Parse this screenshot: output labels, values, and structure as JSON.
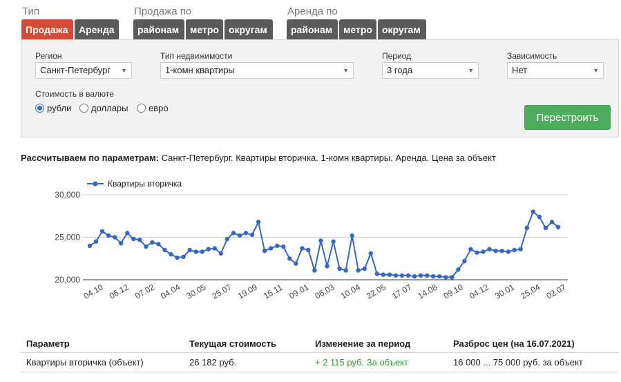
{
  "filters": {
    "type_label": "Тип",
    "sale_by_label": "Продажа по",
    "rent_by_label": "Аренда по",
    "tabs_type": [
      "Продажа",
      "Аренда"
    ],
    "tabs_sale": [
      "районам",
      "метро",
      "округам"
    ],
    "tabs_rent": [
      "районам",
      "метро",
      "округам"
    ],
    "active_tab": "Продажа"
  },
  "panel": {
    "region_label": "Регион",
    "region_value": "Санкт-Петербург",
    "property_label": "Тип недвижимости",
    "property_value": "1-комн квартиры",
    "period_label": "Период",
    "period_value": "3 года",
    "dependency_label": "Зависимость",
    "dependency_value": "Нет",
    "currency_label": "Стоимость в валюте",
    "currency_options": [
      "рубли",
      "доллары",
      "евро"
    ],
    "currency_selected": "рубли",
    "rebuild_label": "Перестроить"
  },
  "summary": {
    "prefix": "Рассчитываем по параметрам:",
    "text": "Санкт-Петербург. Квартиры вторичка. 1-комн квартиры. Аренда. Цена за объект"
  },
  "chart_data": {
    "type": "line",
    "legend_position": "top-left",
    "series": [
      {
        "name": "Квартиры вторичка",
        "color": "#3366cc",
        "values": [
          24000,
          24500,
          25700,
          25200,
          25000,
          24300,
          25500,
          24800,
          24700,
          23900,
          24400,
          24200,
          23500,
          23000,
          22600,
          22700,
          23500,
          23300,
          23300,
          23600,
          23700,
          23100,
          24800,
          25500,
          25200,
          25500,
          25300,
          26800,
          23400,
          23700,
          24000,
          23900,
          22500,
          21900,
          23700,
          23500,
          21100,
          24600,
          21600,
          24500,
          21300,
          21100,
          25200,
          21100,
          21300,
          23100,
          20700,
          20600,
          20600,
          20500,
          20500,
          20500,
          20400,
          20500,
          20500,
          20400,
          20400,
          20300,
          20300,
          21200,
          22200,
          23600,
          23200,
          23300,
          23600,
          23400,
          23400,
          23300,
          23500,
          23600,
          26100,
          28000,
          27400,
          26100,
          26800,
          26200
        ]
      }
    ],
    "x_tick_labels": [
      "04.10",
      "06.12",
      "07.02",
      "04.04",
      "30.05",
      "25.07",
      "19.09",
      "15.11",
      "09.01",
      "06.03",
      "10.04",
      "22.05",
      "17.07",
      "14.08",
      "09.10",
      "04.12",
      "30.01",
      "25.04",
      "02.07"
    ],
    "y_tick_labels": [
      "20,000",
      "25,000",
      "30,000"
    ],
    "ylim": [
      20000,
      30000
    ],
    "grid": true
  },
  "table": {
    "headers": [
      "Параметр",
      "Текущая стоимость",
      "Изменение за период",
      "Разброс цен (на 16.07.2021)"
    ],
    "row": [
      "Квартиры вторичка (объект)",
      "26 182 руб.",
      "+ 2 115 руб. За объект",
      "16 000 ... 75 000 руб. за объект"
    ]
  }
}
